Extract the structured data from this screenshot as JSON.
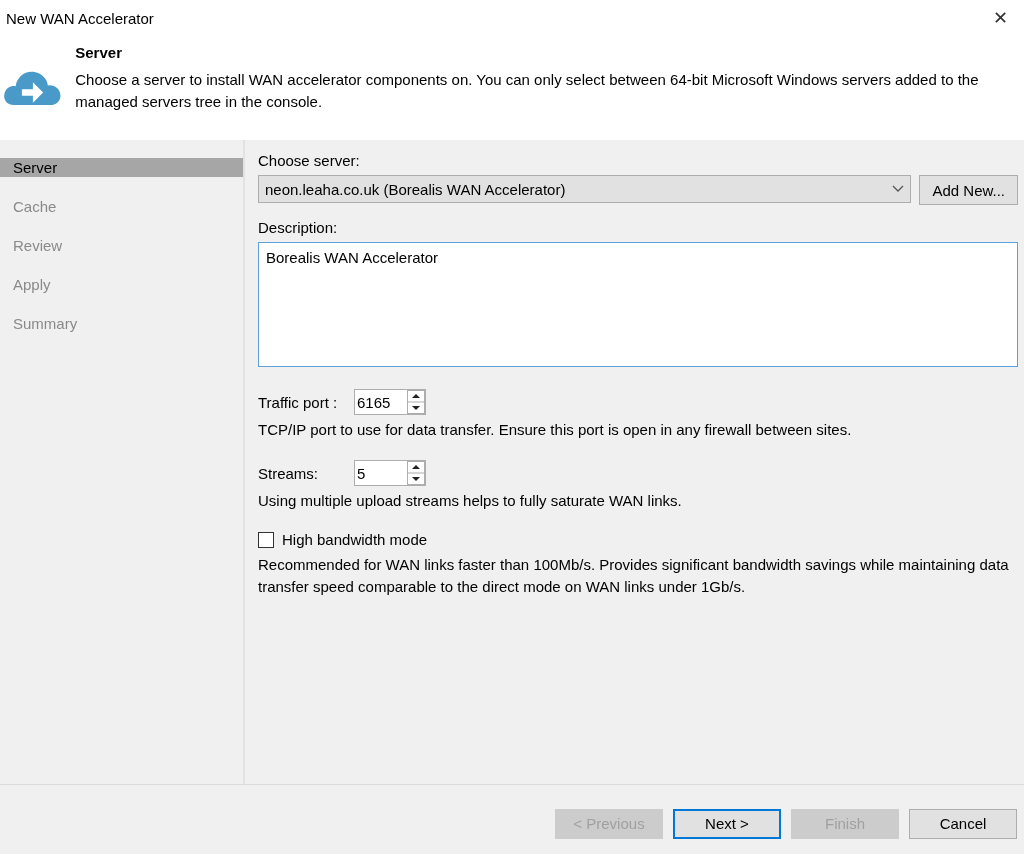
{
  "window": {
    "title": "New WAN Accelerator",
    "close": "✕"
  },
  "header": {
    "title": "Server",
    "description": "Choose a server to install WAN accelerator components on. You can only select between 64-bit Microsoft Windows servers added to the managed servers tree in the console."
  },
  "sidebar": {
    "items": [
      {
        "label": "Server",
        "selected": true
      },
      {
        "label": "Cache",
        "selected": false
      },
      {
        "label": "Review",
        "selected": false
      },
      {
        "label": "Apply",
        "selected": false
      },
      {
        "label": "Summary",
        "selected": false
      }
    ]
  },
  "form": {
    "server_label": "Choose server:",
    "server_value": "neon.leaha.co.uk (Borealis WAN Accelerator)",
    "add_new": "Add New...",
    "description_label": "Description:",
    "description_value": "Borealis WAN Accelerator",
    "traffic_port": {
      "label": "Traffic port :",
      "value": "6165",
      "hint": "TCP/IP port to use for data transfer. Ensure this port is open in any firewall between sites."
    },
    "streams": {
      "label": "Streams:",
      "value": "5",
      "hint": "Using multiple upload streams helps to fully saturate WAN links."
    },
    "high_bandwidth": {
      "label": "High bandwidth mode",
      "checked": false,
      "hint": "Recommended for WAN links faster than 100Mb/s. Provides significant bandwidth savings while maintaining data transfer speed comparable to the direct mode on WAN links under 1Gb/s."
    }
  },
  "buttons": [
    {
      "label": "< Previous",
      "disabled": true,
      "default": false
    },
    {
      "label": "Next >",
      "disabled": false,
      "default": true
    },
    {
      "label": "Finish",
      "disabled": true,
      "default": false
    },
    {
      "label": "Cancel",
      "disabled": false,
      "default": false
    }
  ]
}
